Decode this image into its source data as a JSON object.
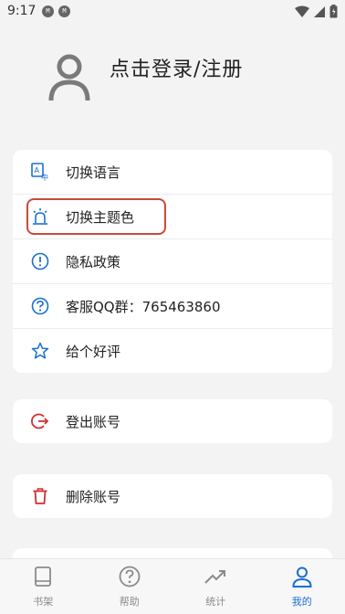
{
  "status_bar": {
    "time": "9:17",
    "badge1": "M",
    "badge2": "M"
  },
  "profile": {
    "login_label": "点击登录/注册"
  },
  "menu_main": [
    {
      "label": "切换语言",
      "icon": "translate-icon"
    },
    {
      "label": "切换主题色",
      "icon": "alarm-light-icon"
    },
    {
      "label": "隐私政策",
      "icon": "info-circle-icon"
    },
    {
      "label": "客服QQ群：765463860",
      "icon": "help-circle-icon"
    },
    {
      "label": "给个好评",
      "icon": "star-outline-icon"
    }
  ],
  "logout": {
    "label": "登出账号",
    "icon": "logout-icon"
  },
  "delete": {
    "label": "删除账号",
    "icon": "trash-icon"
  },
  "tabs": [
    {
      "label": "书架",
      "icon": "book-icon"
    },
    {
      "label": "帮助",
      "icon": "help-icon"
    },
    {
      "label": "统计",
      "icon": "trending-icon"
    },
    {
      "label": "我的",
      "icon": "person-icon"
    }
  ],
  "colors": {
    "accent": "#1a6fd1",
    "danger": "#d32f2f",
    "highlight": "#c84a3b"
  }
}
